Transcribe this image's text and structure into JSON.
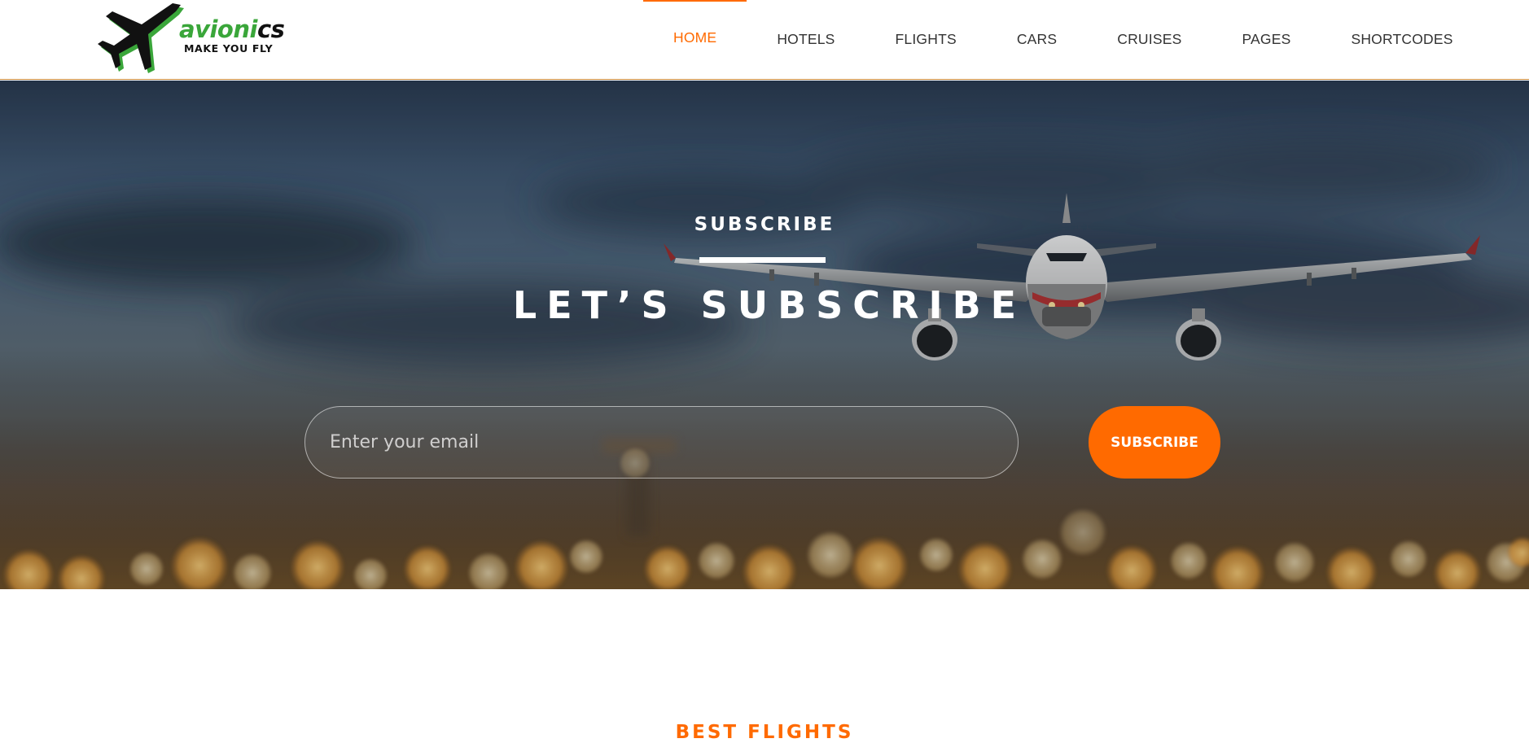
{
  "brand": {
    "name_part1": "avioni",
    "name_part2": "cs",
    "tagline": "MAKE YOU FLY",
    "primary_color": "#3aa63a",
    "logo_icon": "airplane-icon"
  },
  "nav": {
    "items": [
      {
        "label": "HOME",
        "active": true
      },
      {
        "label": "HOTELS",
        "active": false
      },
      {
        "label": "FLIGHTS",
        "active": false
      },
      {
        "label": "CARS",
        "active": false
      },
      {
        "label": "CRUISES",
        "active": false
      },
      {
        "label": "PAGES",
        "active": false
      },
      {
        "label": "SHORTCODES",
        "active": false
      }
    ],
    "active_color": "#ff6a00"
  },
  "hero": {
    "eyebrow": "SUBSCRIBE",
    "title": "LET’S SUBSCRIBE",
    "background": "airplane-landing-dusk-photo",
    "email_placeholder": "Enter your email",
    "email_value": "",
    "button_label": "SUBSCRIBE",
    "button_color": "#ff6a00"
  },
  "next_section": {
    "heading": "BEST FLIGHTS",
    "color": "#ff6a00"
  }
}
